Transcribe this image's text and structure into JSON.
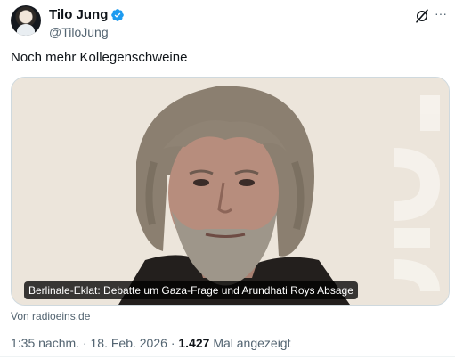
{
  "author": {
    "display_name": "Tilo Jung",
    "handle": "@TiloJung",
    "verified": true,
    "verified_color": "#1d9bf0"
  },
  "actions": {
    "grok_icon": "grok-icon",
    "more_label": "···"
  },
  "tweet": {
    "text": "Noch mehr Kollegenschweine"
  },
  "card": {
    "caption": "Berlinale-Eklat: Debatte um Gaza-Frage und Arundhati Roys Absage",
    "source": "Von radioeins.de",
    "watermark": "eins"
  },
  "meta": {
    "time": "1:35 nachm.",
    "date": "18. Feb. 2026",
    "views": "1.427",
    "views_label": "Mal angezeigt",
    "separator": "·"
  }
}
